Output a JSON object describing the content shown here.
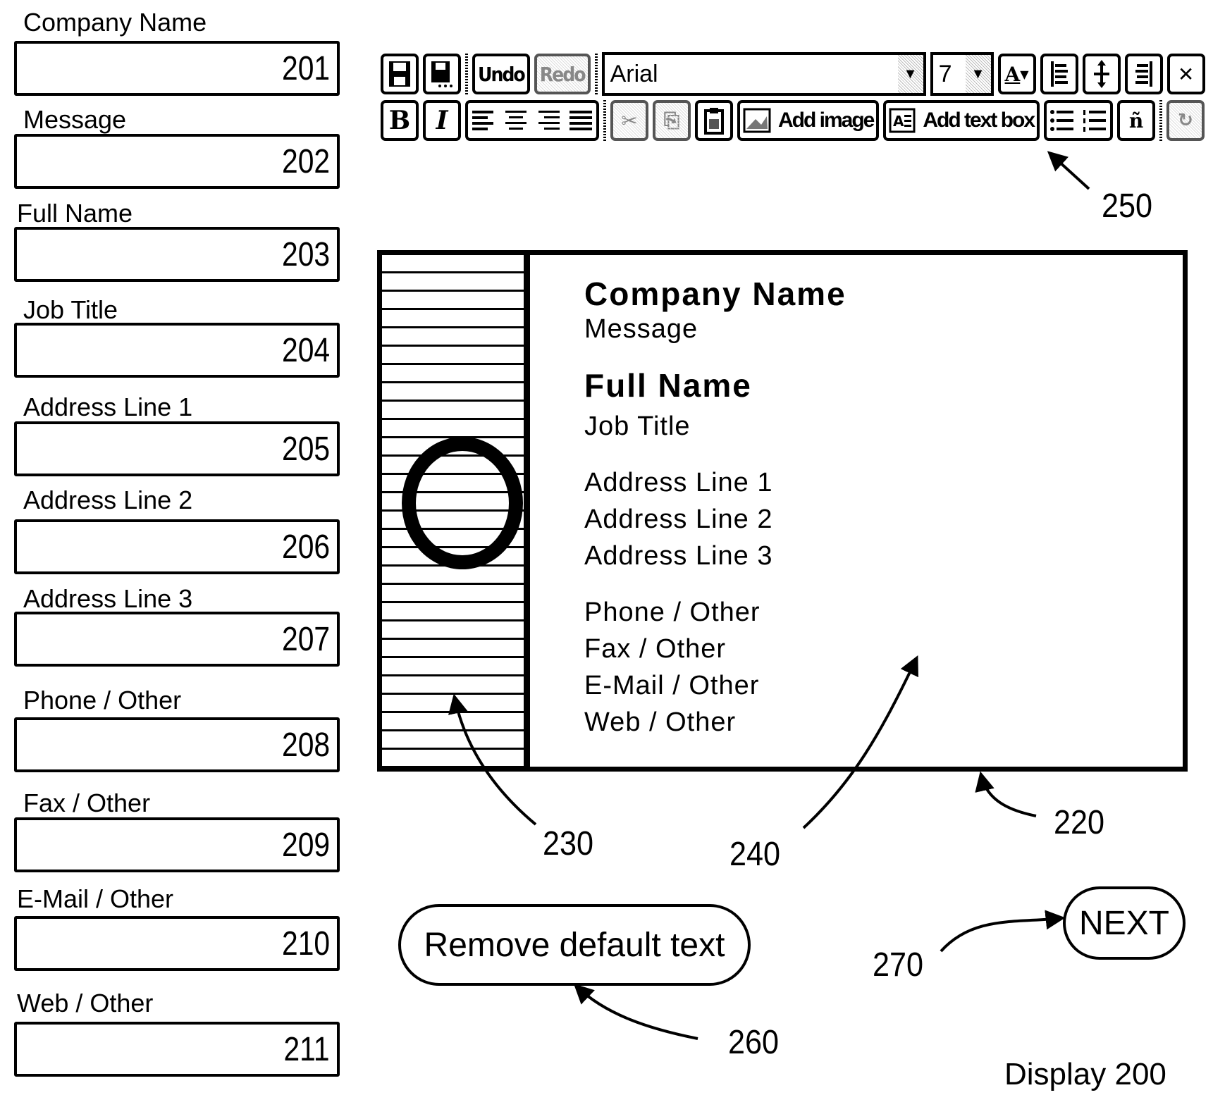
{
  "form": {
    "fields": [
      {
        "label": "Company Name",
        "ref": "201"
      },
      {
        "label": "Message",
        "ref": "202"
      },
      {
        "label": "Full Name",
        "ref": "203"
      },
      {
        "label": "Job Title",
        "ref": "204"
      },
      {
        "label": "Address Line 1",
        "ref": "205"
      },
      {
        "label": "Address Line 2",
        "ref": "206"
      },
      {
        "label": "Address Line 3",
        "ref": "207"
      },
      {
        "label": "Phone / Other",
        "ref": "208"
      },
      {
        "label": "Fax / Other",
        "ref": "209"
      },
      {
        "label": "E-Mail / Other",
        "ref": "210"
      },
      {
        "label": "Web / Other",
        "ref": "211"
      }
    ]
  },
  "toolbar": {
    "undo_label": "Undo",
    "redo_label": "Redo",
    "font_value": "Arial",
    "size_value": "7",
    "bold_label": "B",
    "italic_label": "I",
    "add_image_label": "Add image",
    "add_textbox_label": "Add text box",
    "icons": {
      "save": "save-icon",
      "save_as": "save-as-icon",
      "font_color": "font-color-icon",
      "cut": "cut-icon",
      "copy": "copy-icon",
      "paste": "paste-icon",
      "close": "close-icon"
    }
  },
  "card": {
    "company_name": "Company Name",
    "message": "Message",
    "full_name": "Full Name",
    "job_title": "Job Title",
    "address_1": "Address Line 1",
    "address_2": "Address Line 2",
    "address_3": "Address Line 3",
    "phone": "Phone / Other",
    "fax": "Fax / Other",
    "email": "E-Mail / Other",
    "web": "Web / Other",
    "logo_letter": "O"
  },
  "buttons": {
    "remove_default_text": "Remove default text",
    "next": "NEXT"
  },
  "refs": {
    "toolbar": "250",
    "card": "220",
    "logo_area": "230",
    "text_area": "240",
    "remove_button": "260",
    "next_button": "270"
  },
  "display_label": "Display 200"
}
